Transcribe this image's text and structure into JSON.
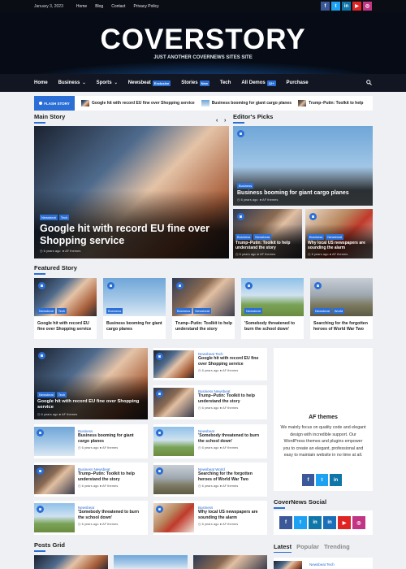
{
  "topbar": {
    "date": "January 3, 2023",
    "links": [
      "Home",
      "Blog",
      "Contact",
      "Privacy Policy"
    ],
    "social_icons": [
      {
        "name": "facebook-icon",
        "glyph": "f",
        "color": "#3b5998"
      },
      {
        "name": "twitter-icon",
        "glyph": "t",
        "color": "#1da1f2"
      },
      {
        "name": "linkedin-icon",
        "glyph": "in",
        "color": "#0e76a8"
      },
      {
        "name": "youtube-icon",
        "glyph": "▶",
        "color": "#e02424"
      },
      {
        "name": "instagram-icon",
        "glyph": "◎",
        "color": "#c13584"
      }
    ]
  },
  "site": {
    "title": "COVERSTORY",
    "tagline": "JUST ANOTHER COVERNEWS SITES SITE"
  },
  "nav": {
    "items": [
      "Home",
      "Business",
      "Sports",
      "Newsbeat",
      "Stories",
      "Tech",
      "All Demos",
      "Purchase"
    ],
    "badges": {
      "newsbeat": "Exclusive",
      "stories": "New",
      "all_demos": "12+"
    }
  },
  "ticker": {
    "label": "FLASH STORY",
    "items": [
      "Google hit with record EU fine over Shopping service",
      "Business booming for giant cargo planes",
      "Trump–Putin: Toolkit to help"
    ]
  },
  "main_story": {
    "heading": "Main Story",
    "title": "Google hit with record EU fine over Shopping service",
    "tags": [
      "Newsbeat",
      "Tech"
    ],
    "time": "6 years ago",
    "author": "AF themes"
  },
  "editors_picks": {
    "heading": "Editor's Picks",
    "large": {
      "title": "Business booming for giant cargo planes",
      "tags": [
        "Business"
      ],
      "time": "6 years ago",
      "author": "AF themes"
    },
    "small": [
      {
        "title": "Trump–Putin: Toolkit to help understand the story",
        "tags": [
          "Business",
          "Newsbeat"
        ],
        "time": "6 years ago",
        "author": "AF themes"
      },
      {
        "title": "Why local US newspapers are sounding the alarm",
        "tags": [
          "Business",
          "Newsbeat"
        ],
        "time": "6 years ago",
        "author": "AF themes"
      }
    ]
  },
  "featured": {
    "heading": "Featured Story",
    "cards": [
      {
        "title": "Google hit with record EU fine over Shopping service",
        "tags": [
          "Newsbeat",
          "Tech"
        ]
      },
      {
        "title": "Business booming for giant cargo planes",
        "tags": [
          "Business"
        ]
      },
      {
        "title": "Trump–Putin: Toolkit to help understand the story",
        "tags": [
          "Business",
          "Newsbeat"
        ]
      },
      {
        "title": "'Somebody threatened to burn the school down'",
        "tags": [
          "Newsbeat"
        ]
      },
      {
        "title": "Searching for the forgotten heroes of World War Two",
        "tags": [
          "Newsbeat",
          "World"
        ]
      }
    ]
  },
  "grid_big": {
    "title": "Google hit with record EU fine over Shopping service",
    "tags": [
      "Newsbeat",
      "Tech"
    ],
    "time": "6 years ago",
    "author": "AF themes"
  },
  "right_list": [
    {
      "title": "Google hit with record EU fine over Shopping service",
      "tags": "Newsbeat  Tech",
      "time": "6 years ago",
      "author": "AF themes"
    },
    {
      "title": "Trump–Putin: Toolkit to help understand the story",
      "tags": "Business  Newsbeat",
      "time": "6 years ago",
      "author": "AF themes"
    }
  ],
  "rows": [
    {
      "title": "Business booming for giant cargo planes",
      "tags": "Business",
      "time": "6 years ago",
      "author": "AF themes"
    },
    {
      "title": "'Somebody threatened to burn the school down'",
      "tags": "Newsbeat",
      "time": "6 years ago",
      "author": "AF themes"
    },
    {
      "title": "Trump–Putin: Toolkit to help understand the story",
      "tags": "Business  Newsbeat",
      "time": "6 years ago",
      "author": "AF themes"
    },
    {
      "title": "Searching for the forgotten heroes of World War Two",
      "tags": "Newsbeat  World",
      "time": "6 years ago",
      "author": "AF themes"
    },
    {
      "title": "'Somebody threatened to burn the school down'",
      "tags": "Newsbeat",
      "time": "6 years ago",
      "author": "AF themes"
    },
    {
      "title": "Why local US newspapers are sounding the alarm",
      "tags": "Business",
      "time": "6 years ago",
      "author": "AF themes"
    }
  ],
  "sidebar": {
    "af_title": "AF themes",
    "af_text": "We mainly focus on quality code and elegant design with incredible support. Our WordPress themes and plugins empower you to create an elegant, professional and easy to maintain website in no time at all.",
    "social_heading": "CoverNews Social",
    "tabs": [
      "Latest",
      "Popular",
      "Trending"
    ],
    "latest_tags": "Newsbeat  Tech"
  },
  "posts_grid": {
    "heading": "Posts Grid"
  }
}
